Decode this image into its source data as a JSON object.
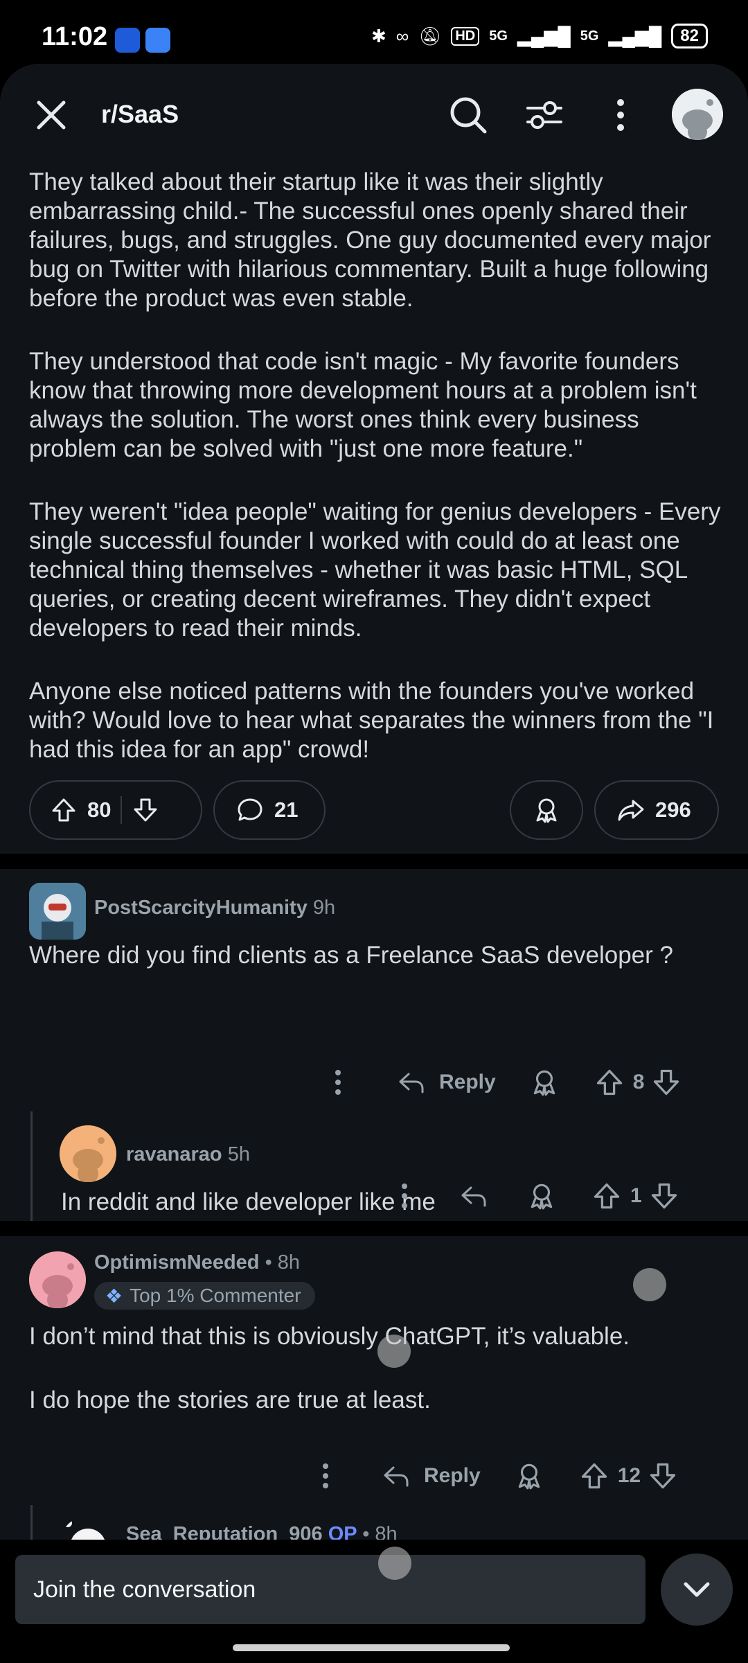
{
  "status_bar": {
    "time": "11:02",
    "network_1": "5G",
    "network_2": "5G",
    "hd_label": "HD",
    "battery": "82"
  },
  "header": {
    "subreddit": "r/SaaS"
  },
  "post": {
    "paragraphs": [
      "They talked about their startup like it was their slightly embarrassing child.- The successful ones openly shared their failures, bugs, and struggles. One guy documented every major bug on Twitter with hilarious commentary. Built a huge following before the product was even stable.",
      "They understood that code isn't magic - My favorite founders know that throwing more development hours at a problem isn't always the solution. The worst ones think every business problem can be solved with \"just one more feature.\"",
      "They weren't \"idea people\" waiting for genius developers - Every single successful founder I worked with could do at least one technical thing themselves - whether it was basic HTML, SQL queries, or creating decent wireframes. They didn't expect developers to read their minds.",
      "Anyone else noticed patterns with the founders you've worked with? Would love to hear what separates the winners from the \"I had this idea for an app\" crowd!"
    ],
    "upvotes": "80",
    "comments": "21",
    "shares": "296"
  },
  "comments": [
    {
      "username": "PostScarcityHumanity",
      "time": "9h",
      "text": "Where did you find clients as a Freelance SaaS developer ?",
      "reply_label": "Reply",
      "votes": "8"
    },
    {
      "username": "ravanarao",
      "time": "5h",
      "text": "In reddit and like developer like me",
      "votes": "1"
    },
    {
      "username": "OptimismNeeded",
      "time": "• 8h",
      "badge": "Top 1% Commenter",
      "text_1": "I don’t mind that this is obviously ChatGPT, it’s valuable.",
      "text_2": "I do hope the stories are true at least.",
      "reply_label": "Reply",
      "votes": "12"
    },
    {
      "username": "Sea_Reputation_906",
      "op_label": "OP",
      "time": "• 8h"
    }
  ],
  "composer": {
    "placeholder": "Join the conversation"
  },
  "colors": {
    "background": "#101418",
    "text": "#d6d9db",
    "muted": "#9aa3ab",
    "op_accent": "#6c8cff"
  }
}
